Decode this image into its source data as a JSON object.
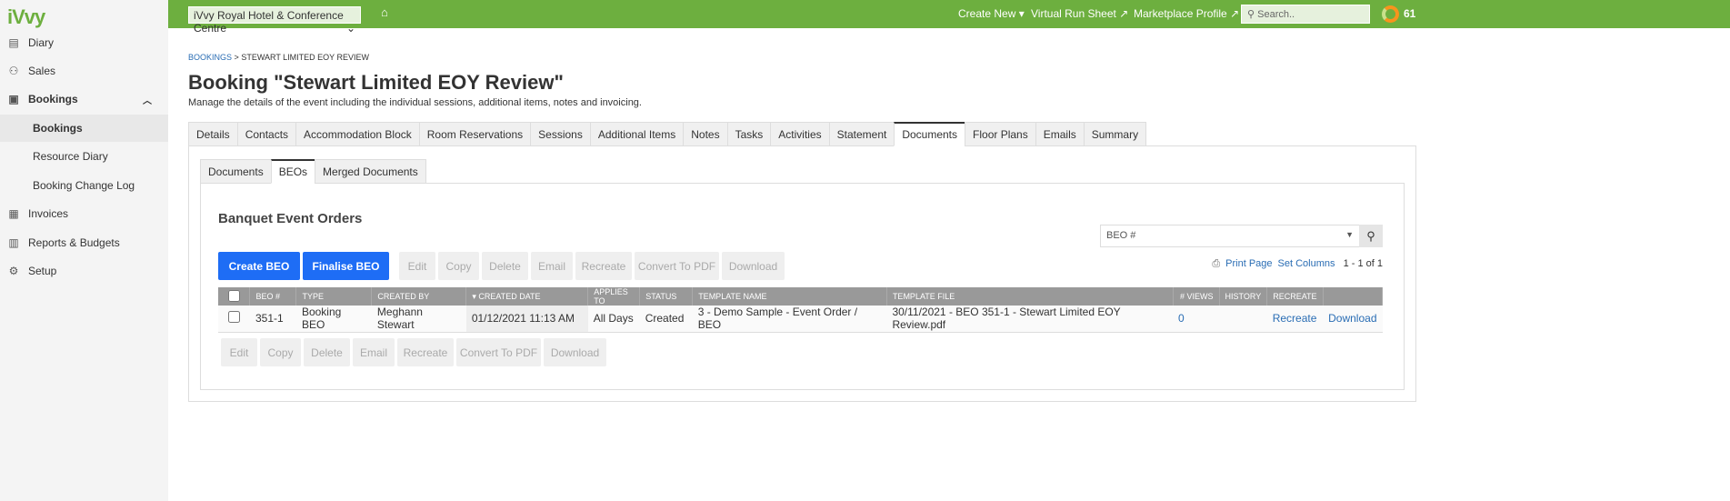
{
  "app": {
    "logo": "iVvy",
    "venue": "iVvy Royal Hotel & Conference Centre",
    "create_new": "Create New",
    "virtual_run_sheet": "Virtual Run Sheet",
    "marketplace_profile": "Marketplace Profile",
    "search_placeholder": "Search..",
    "score": "61"
  },
  "sidebar": {
    "diary": "Diary",
    "sales": "Sales",
    "bookings": "Bookings",
    "bookings_sub": "Bookings",
    "resource_diary": "Resource Diary",
    "change_log": "Booking Change Log",
    "invoices": "Invoices",
    "reports": "Reports & Budgets",
    "setup": "Setup"
  },
  "breadcrumb": {
    "root": "BOOKINGS",
    "sep": ">",
    "current": "STEWART LIMITED EOY REVIEW"
  },
  "page": {
    "title": "Booking \"Stewart Limited EOY Review\"",
    "description": "Manage the details of the event including the individual sessions, additional items, notes and invoicing."
  },
  "tabs": [
    "Details",
    "Contacts",
    "Accommodation Block",
    "Room Reservations",
    "Sessions",
    "Additional Items",
    "Notes",
    "Tasks",
    "Activities",
    "Statement",
    "Documents",
    "Floor Plans",
    "Emails",
    "Summary"
  ],
  "subtabs": [
    "Documents",
    "BEOs",
    "Merged Documents"
  ],
  "section": {
    "title": "Banquet Event Orders",
    "create": "Create BEO",
    "finalise": "Finalise BEO",
    "actions": [
      "Edit",
      "Copy",
      "Delete",
      "Email",
      "Recreate",
      "Convert To PDF",
      "Download"
    ],
    "filter": "BEO #",
    "print": "Print Page",
    "set_columns": "Set Columns",
    "count": "1 - 1 of 1"
  },
  "table": {
    "headers": [
      "BEO #",
      "TYPE",
      "CREATED BY",
      "CREATED DATE",
      "APPLIES TO",
      "STATUS",
      "TEMPLATE NAME",
      "TEMPLATE FILE",
      "# VIEWS",
      "HISTORY",
      "RECREATE",
      ""
    ],
    "row": {
      "beo": "351-1",
      "type": "Booking BEO",
      "created_by": "Meghann Stewart",
      "created_date": "01/12/2021 11:13 AM",
      "applies_to": "All Days",
      "status": "Created",
      "template_name": "3 - Demo Sample - Event Order / BEO",
      "template_file": "30/11/2021 - BEO 351-1 - Stewart Limited EOY Review.pdf",
      "views": "0",
      "recreate": "Recreate",
      "download": "Download"
    }
  }
}
